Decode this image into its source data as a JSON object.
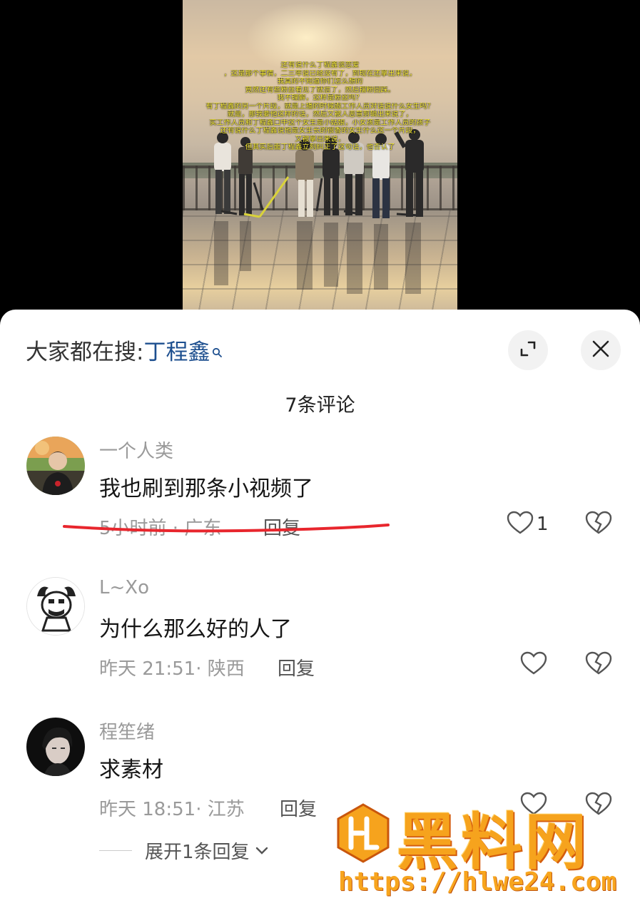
{
  "video": {
    "caption_lines": [
      "还有说什么丁程鑫谈恋爱",
      "，这是那个事情，二三年说已经没有了，到现在还拿出来说，",
      "我真的不知道你们怎么想的",
      "竟然还有些粉丝看见了就信了，然后摆粉回踩。",
      "我不理解，这样是粉丝吗？",
      "有丁程鑫的另一个片段，就是上播的时候跟工作人员对话说什么女生吗？",
      "就是，那我要他这样的话，然后又被人恶意剪辑出来说了，",
      "实工作人员和丁程鑫口中这个女生是小姑娘，小女孩是工作人员的孩子",
      "还有说什么丁程鑫说他是女生长的很香的女生什么这一个片段，",
      "又被拿出来说，",
      "但其实后面丁程鑫立刻纠正了这句话，也否认了"
    ]
  },
  "search_bar": {
    "prefix": "大家都在搜: ",
    "term": "丁程鑫"
  },
  "header": {
    "comments_count_label": "7条评论"
  },
  "comments": [
    {
      "username": "一个人类",
      "text": "我也刷到那条小视频了",
      "meta": "5小时前 · 广东",
      "reply_label": "回复",
      "like_count": "1"
    },
    {
      "username": "L~Xo",
      "text": "为什么那么好的人了",
      "meta": "昨天 21:51· 陕西",
      "reply_label": "回复",
      "like_count": ""
    },
    {
      "username": "程笙绪",
      "text": "求素材",
      "meta": "昨天 18:51· 江苏",
      "reply_label": "回复",
      "like_count": ""
    }
  ],
  "expand_replies_label": "展开1条回复",
  "watermark": {
    "title": "黑料网",
    "url": "https://hlwe24.com"
  },
  "colors": {
    "search_term": "#1d4f8f",
    "annotation_underline": "#e8262d",
    "watermark": "#f6a31d"
  },
  "icons": [
    "search-icon",
    "expand-icon",
    "close-icon",
    "heart-icon",
    "broken-heart-icon",
    "chevron-down-icon"
  ]
}
